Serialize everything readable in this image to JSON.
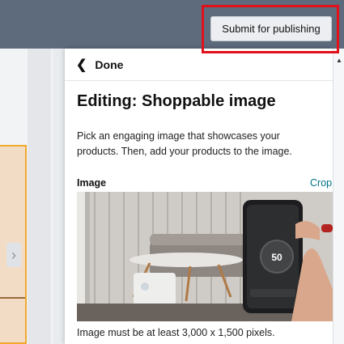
{
  "header": {
    "publish_label": "Submit for publishing"
  },
  "panel": {
    "back_label": "Done",
    "title": "Editing: Shoppable image",
    "description": "Pick an engaging image that showcases your products. Then, add your products to the image.",
    "image_label": "Image",
    "crop_label": "Crop",
    "image_hint": "Image must be at least 3,000 x 1,500 pixels."
  },
  "photo": {
    "thermostat_value": "50"
  },
  "colors": {
    "topbar": "#5d6b7d",
    "highlight": "#e0111b",
    "link": "#007185"
  }
}
